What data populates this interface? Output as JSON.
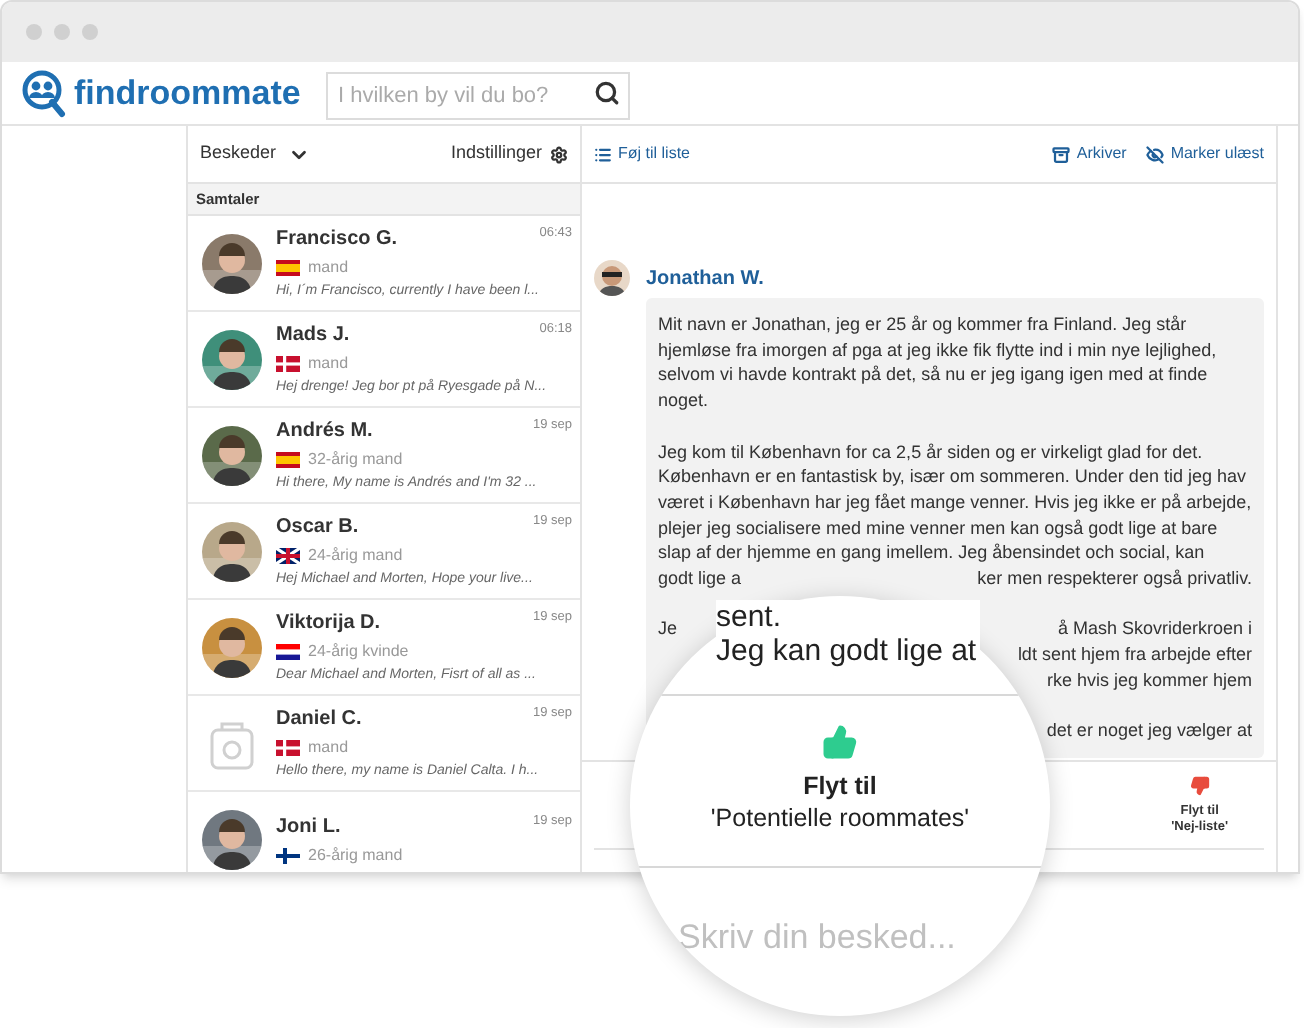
{
  "brand": "findroommate",
  "search": {
    "placeholder": "I hvilken by vil du bo?"
  },
  "list_header": {
    "folder": "Beskeder",
    "settings": "Indstillinger"
  },
  "section": "Samtaler",
  "conversations": [
    {
      "name": "Francisco G.",
      "flag": {
        "kind": "spain"
      },
      "info": "mand",
      "preview": "Hi, I´m Francisco, currently I have been l...",
      "time": "06:43"
    },
    {
      "name": "Mads J.",
      "flag": {
        "kind": "denmark"
      },
      "info": "mand",
      "preview": "Hej drenge! Jeg bor pt på Ryesgade på N...",
      "time": "06:18"
    },
    {
      "name": "Andrés M.",
      "flag": {
        "kind": "spain"
      },
      "info": "32-årig mand",
      "preview": "Hi there, My name is Andrés and I'm 32 ...",
      "time": "19 sep"
    },
    {
      "name": "Oscar B.",
      "flag": {
        "kind": "uk"
      },
      "info": "24-årig mand",
      "preview": "Hej Michael and Morten, Hope your live...",
      "time": "19 sep"
    },
    {
      "name": "Viktorija D.",
      "flag": {
        "kind": "croatia"
      },
      "info": "24-årig kvinde",
      "preview": "Dear Michael and Morten, Fisrt of all as ...",
      "time": "19 sep"
    },
    {
      "name": "Daniel C.",
      "flag": {
        "kind": "denmark"
      },
      "info": "mand",
      "preview": "Hello there, my name is Daniel Calta. I h...",
      "time": "19 sep",
      "avatar": {
        "kind": "placeholder",
        "color": "#d0d0d0"
      }
    },
    {
      "name": "Joni L.",
      "flag": {
        "kind": "finland"
      },
      "info": "26-årig mand",
      "time": "19 sep"
    }
  ],
  "toolbar": {
    "add_to_list": "Føj til liste",
    "archive": "Arkiver",
    "mark_unread": "Marker ulæst"
  },
  "message": {
    "sender": "Jonathan W.",
    "paragraph_1": "Mit navn er Jonathan, jeg er 25 år og kommer fra Finland. Jeg står hjemløse fra imorgen af pga at jeg ikke fik flytte ind i min nye lejlighed, selvom vi havde kontrakt på det, så nu er jeg igang igen med at finde noget.",
    "paragraph_2": "Jeg kom til København for ca 2,5 år siden og er virkeligt glad for det. København er en fantastisk by, især om sommeren. Under den tid jeg hav været i København har jeg fået mange venner. Hvis jeg ikke er på arbejde, plejer jeg socialisere med mine venner men kan også godt lige at bare slap af der hjemme en gang imellem. Jeg åbensindet och social, kan",
    "fragments": [
      {
        "left": "godt lige a",
        "right": "ker men respekterer også privatliv."
      },
      {
        "left": "Je",
        "right": "å Mash Skovriderkroen i"
      },
      {
        "right": "ldt sent hjem fra arbejde efter"
      },
      {
        "right": "rke hvis jeg kommer hjem"
      }
    ],
    "tail": "det er noget jeg vælger at"
  },
  "reject": {
    "line_1": "Flyt til",
    "line_2": "'Nej-liste'"
  },
  "magnifier": {
    "text_1": "sent.",
    "text_2": "Jeg kan godt lige at",
    "accept_1": "Flyt til",
    "accept_2": "'Potentielle roommates'",
    "placeholder": "Skriv din besked..."
  }
}
